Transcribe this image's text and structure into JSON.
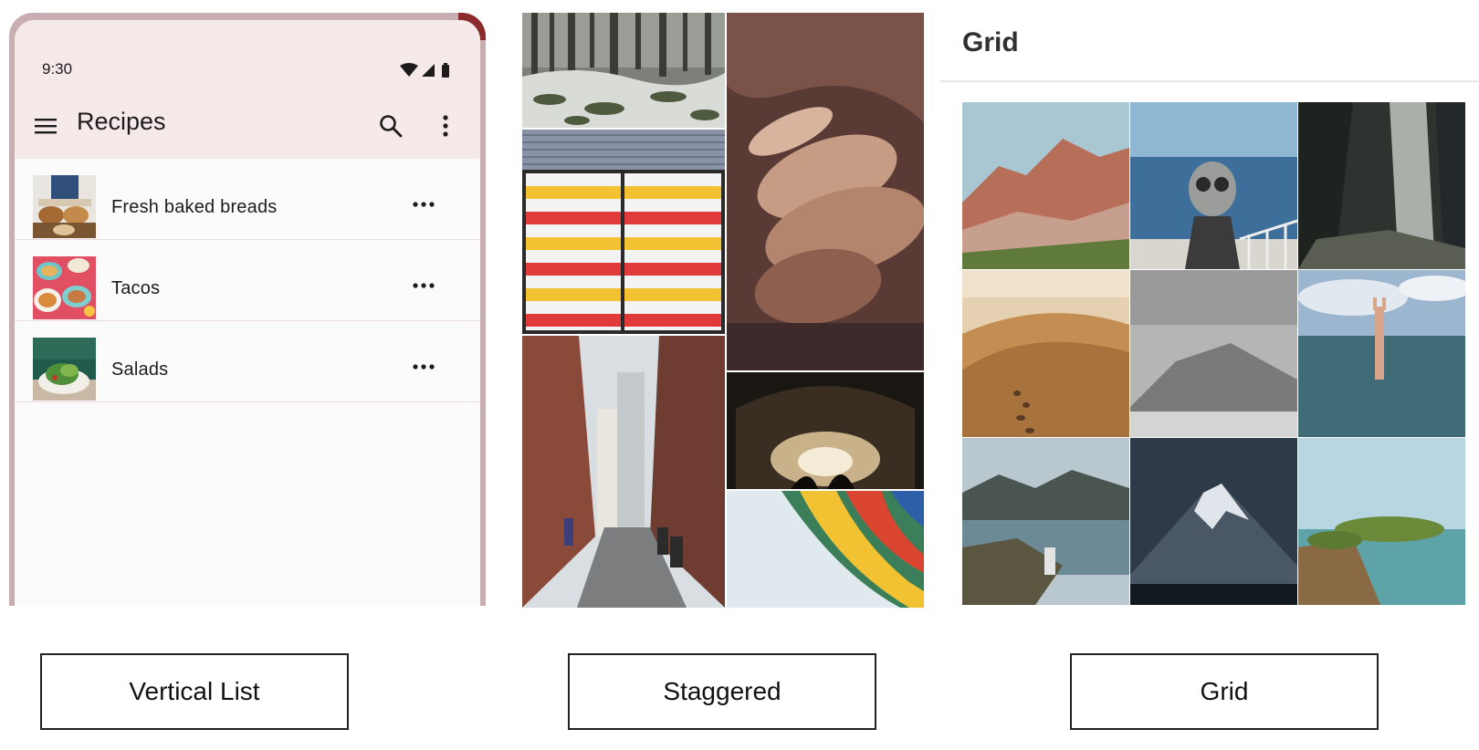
{
  "phone": {
    "status_time": "9:30",
    "app_title": "Recipes",
    "icons": {
      "menu": "hamburger-menu-icon",
      "search": "search-icon",
      "more": "more-vert-icon",
      "status": [
        "wifi-icon",
        "signal-icon",
        "battery-icon"
      ]
    },
    "list_items": [
      {
        "label": "Fresh baked breads",
        "thumb": "bread-photo"
      },
      {
        "label": "Tacos",
        "thumb": "tacos-photo"
      },
      {
        "label": "Salads",
        "thumb": "salad-photo"
      }
    ]
  },
  "staggered": {
    "tiles": [
      "snowy-forest",
      "hand-closeup",
      "striped-wall",
      "city-alley",
      "concert-stage",
      "hot-air-balloon"
    ]
  },
  "grid": {
    "title": "Grid",
    "cells": [
      "red-rock-canyon",
      "binocular-viewer",
      "cave-light-beam",
      "desert-dunes",
      "misty-mountain",
      "hand-in-sea",
      "lake-overlook",
      "snowy-peak",
      "lakeside-island"
    ]
  },
  "captions": {
    "vertical_list": "Vertical List",
    "staggered": "Staggered",
    "grid": "Grid"
  },
  "colors": {
    "phone_frame": "#c8aeb0",
    "appbar": "#f5e9ea",
    "screen": "#fcfbfb",
    "divider": "#ecdcdd"
  }
}
